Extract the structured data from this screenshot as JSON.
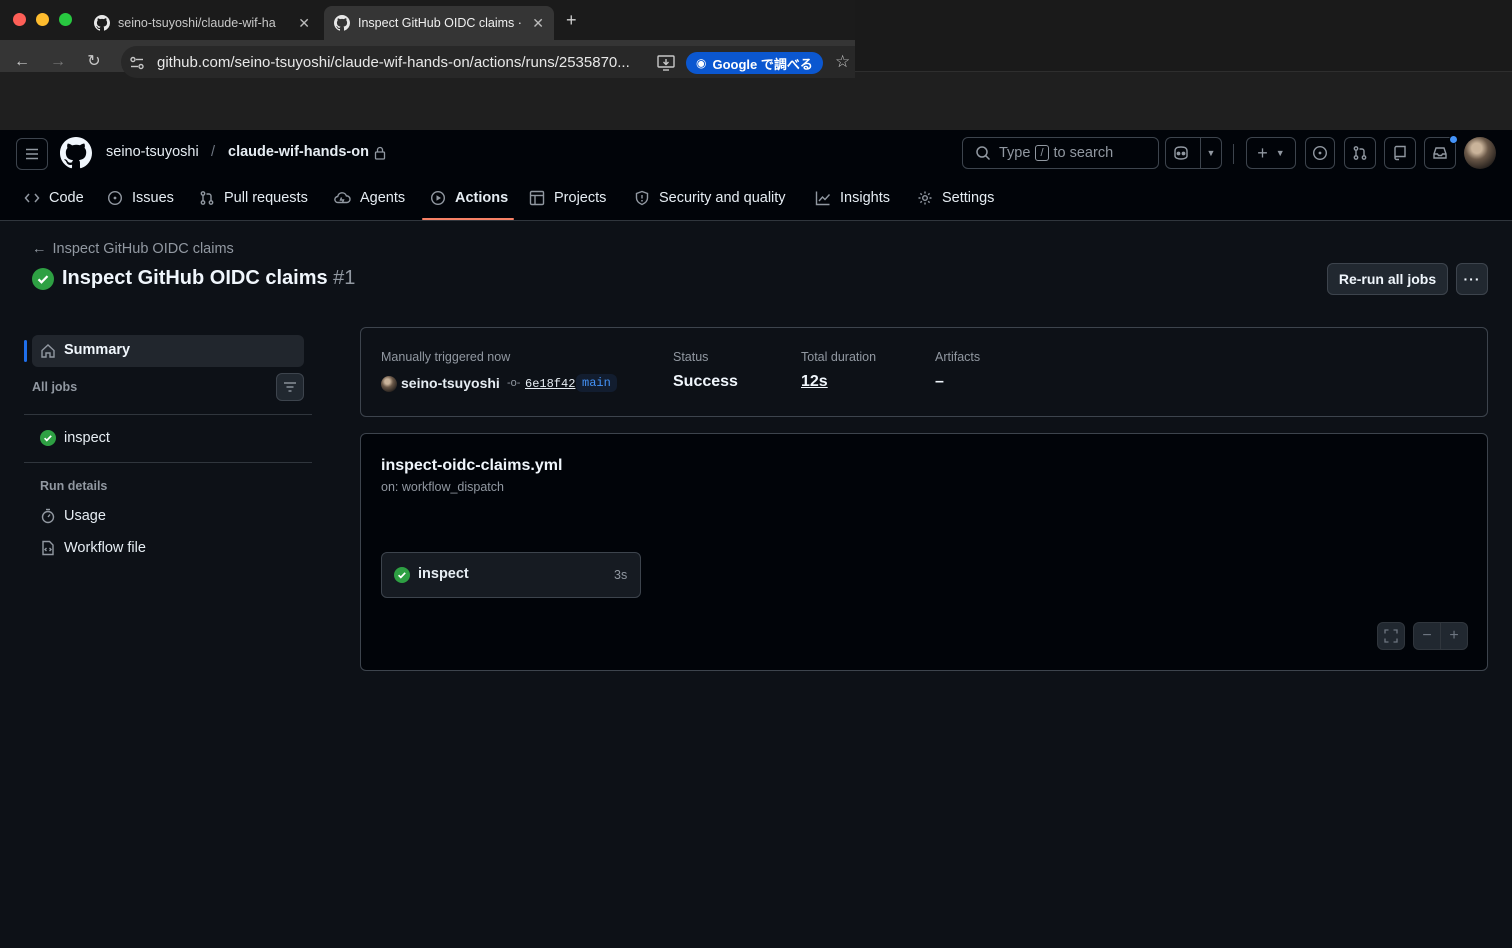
{
  "browser": {
    "tabs": [
      {
        "title": "seino-tsuyoshi/claude-wif-ha",
        "active": false
      },
      {
        "title": "Inspect GitHub OIDC claims ·",
        "active": true
      }
    ],
    "new_tab": "+",
    "url": "github.com/seino-tsuyoshi/claude-wif-hands-on/actions/runs/2535870...",
    "google_lens": "Google で調べる"
  },
  "header": {
    "owner": "seino-tsuyoshi",
    "separator": "/",
    "repo": "claude-wif-hands-on",
    "search_prefix": "Type",
    "search_key": "/",
    "search_suffix": "to search"
  },
  "repo_nav": [
    {
      "label": "Code",
      "icon": "code-icon"
    },
    {
      "label": "Issues",
      "icon": "issue-icon"
    },
    {
      "label": "Pull requests",
      "icon": "pull-request-icon"
    },
    {
      "label": "Agents",
      "icon": "agents-icon"
    },
    {
      "label": "Actions",
      "icon": "play-icon",
      "selected": true
    },
    {
      "label": "Projects",
      "icon": "table-icon"
    },
    {
      "label": "Security and quality",
      "icon": "shield-icon"
    },
    {
      "label": "Insights",
      "icon": "graph-icon"
    },
    {
      "label": "Settings",
      "icon": "gear-icon"
    }
  ],
  "run": {
    "back_link": "Inspect GitHub OIDC claims",
    "title": "Inspect GitHub OIDC claims",
    "number": "#1",
    "rerun_label": "Re-run all jobs",
    "more_label": "···"
  },
  "sidebar": {
    "summary": "Summary",
    "all_jobs": "All jobs",
    "jobs": [
      {
        "name": "inspect",
        "status": "success"
      }
    ],
    "run_details": "Run details",
    "usage": "Usage",
    "workflow_file": "Workflow file"
  },
  "summary": {
    "trigger_label": "Manually triggered now",
    "actor": "seino-tsuyoshi",
    "commit": "6e18f42",
    "branch": "main",
    "status_label": "Status",
    "status_value": "Success",
    "duration_label": "Total duration",
    "duration_value": "12s",
    "artifacts_label": "Artifacts",
    "artifacts_value": "–"
  },
  "workflow": {
    "file": "inspect-oidc-claims.yml",
    "on": "on: workflow_dispatch",
    "job_name": "inspect",
    "job_duration": "3s"
  },
  "colors": {
    "accent_success": "#2ea043",
    "underline_selected": "#f78166",
    "link_blue": "#4493f8",
    "bg": "#0d1117"
  }
}
